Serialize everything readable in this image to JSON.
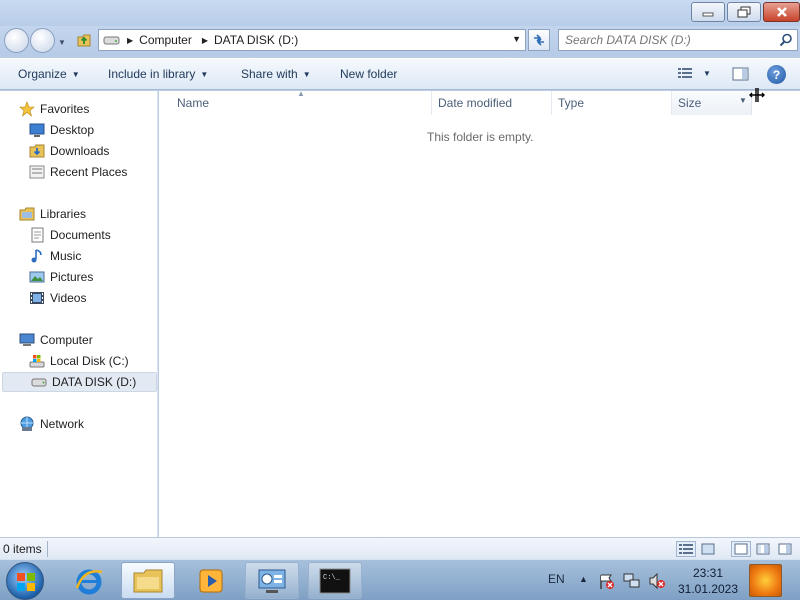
{
  "window": {
    "controls": {
      "minimize": "minimize",
      "maximize": "restore",
      "close": "close"
    }
  },
  "address_bar": {
    "breadcrumbs": [
      "Computer",
      "DATA DISK (D:)"
    ],
    "search_placeholder": "Search DATA DISK (D:)"
  },
  "command_bar": {
    "organize": "Organize",
    "include_in_library": "Include in library",
    "share_with": "Share with",
    "new_folder": "New folder",
    "help": "?"
  },
  "nav_pane": {
    "favorites": {
      "label": "Favorites",
      "items": [
        "Desktop",
        "Downloads",
        "Recent Places"
      ]
    },
    "libraries": {
      "label": "Libraries",
      "items": [
        "Documents",
        "Music",
        "Pictures",
        "Videos"
      ]
    },
    "computer": {
      "label": "Computer",
      "items": [
        "Local Disk (C:)",
        "DATA DISK (D:)"
      ],
      "selected": "DATA DISK (D:)"
    },
    "network": {
      "label": "Network"
    }
  },
  "content": {
    "columns": [
      "Name",
      "Date modified",
      "Type",
      "Size"
    ],
    "empty_message": "This folder is empty."
  },
  "status_bar": {
    "items_count": "0 items"
  },
  "taskbar": {
    "language": "EN",
    "time": "23:31",
    "date": "31.01.2023",
    "pinned": [
      "internet-explorer",
      "windows-explorer",
      "media-player",
      "control-panel",
      "command-prompt"
    ],
    "cmd_label": "C:\\_"
  },
  "colors": {
    "window_frame": "#b9cde5",
    "command_bar_text": "#1e395b",
    "empty_text": "#6a6a6a",
    "taskbar": "#7fa0c4"
  }
}
